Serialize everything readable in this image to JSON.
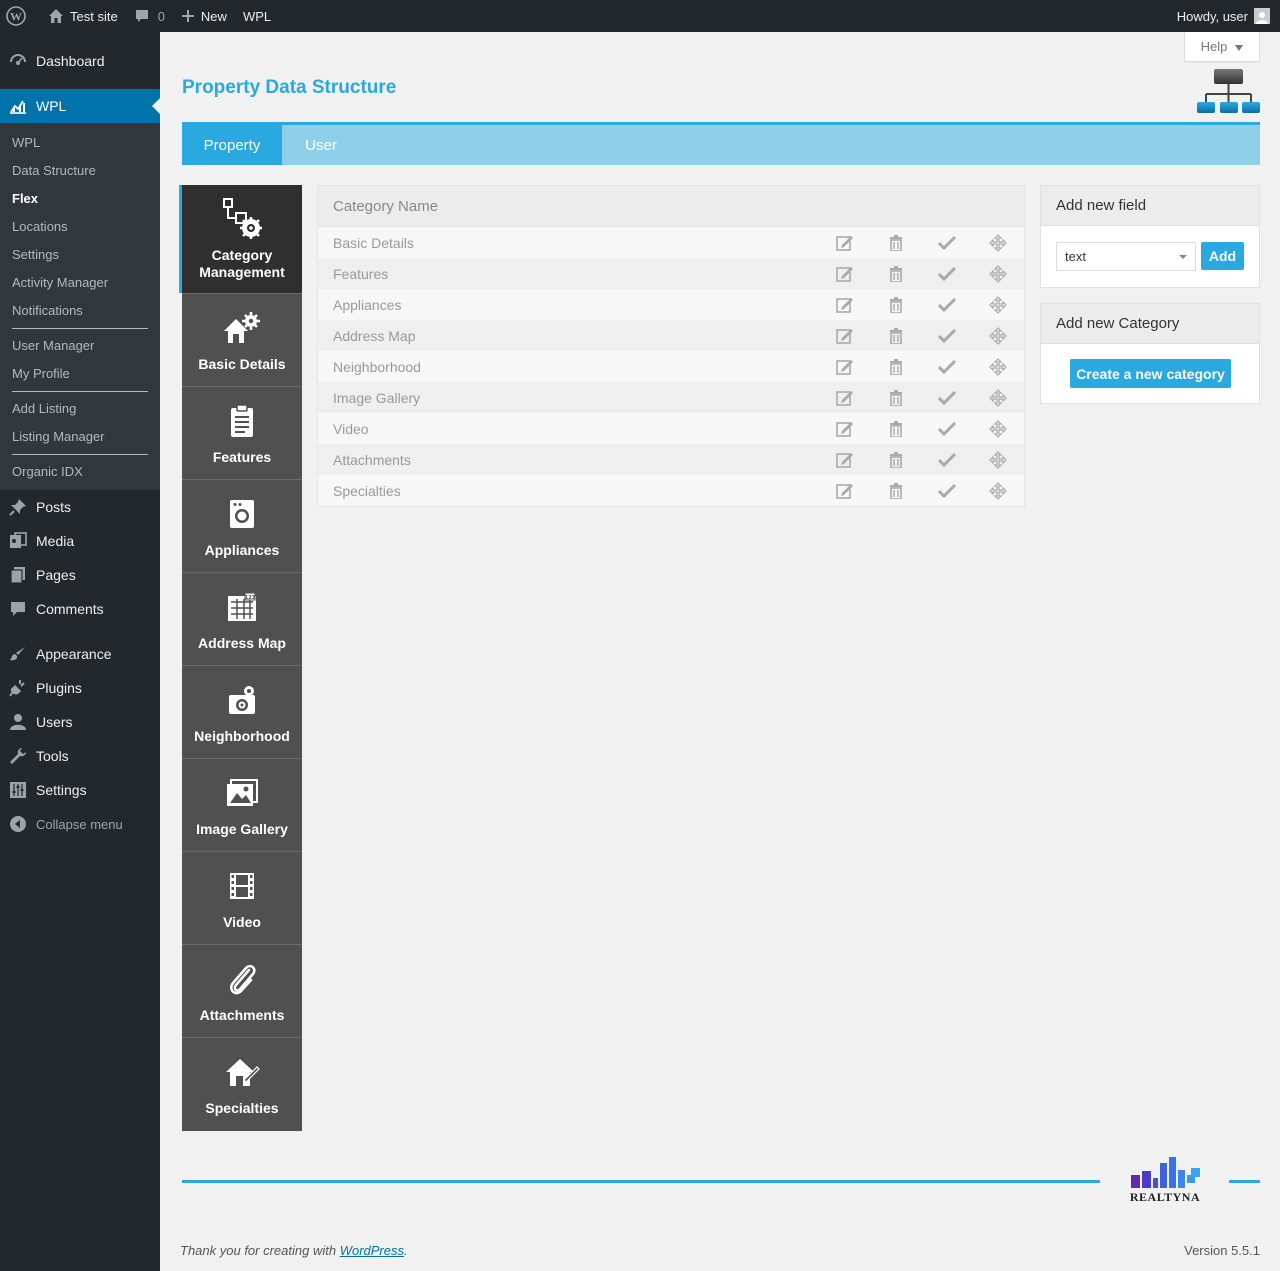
{
  "adminbar": {
    "site_name": "Test site",
    "comments_count": "0",
    "new_label": "New",
    "wpl_label": "WPL",
    "howdy": "Howdy, user"
  },
  "sidebar": {
    "dashboard": "Dashboard",
    "wpl": "WPL",
    "submenu": [
      "WPL",
      "Data Structure",
      "Flex",
      "Locations",
      "Settings",
      "Activity Manager",
      "Notifications",
      "User Manager",
      "My Profile",
      "Add Listing",
      "Listing Manager",
      "Organic IDX"
    ],
    "active_sub": "Flex",
    "posts": "Posts",
    "media": "Media",
    "pages": "Pages",
    "comments": "Comments",
    "appearance": "Appearance",
    "plugins": "Plugins",
    "users": "Users",
    "tools": "Tools",
    "settings": "Settings",
    "collapse": "Collapse menu"
  },
  "help_label": "Help",
  "page_title": "Property Data Structure",
  "tabs": [
    {
      "label": "Property",
      "active": true
    },
    {
      "label": "User",
      "active": false
    }
  ],
  "categories": [
    {
      "label": "Category Management",
      "icon": "category-management-icon"
    },
    {
      "label": "Basic Details",
      "icon": "house-gear-icon"
    },
    {
      "label": "Features",
      "icon": "clipboard-icon"
    },
    {
      "label": "Appliances",
      "icon": "washing-machine-icon"
    },
    {
      "label": "Address Map",
      "icon": "map-icon"
    },
    {
      "label": "Neighborhood",
      "icon": "neighborhood-icon"
    },
    {
      "label": "Image Gallery",
      "icon": "image-gallery-icon"
    },
    {
      "label": "Video",
      "icon": "film-icon"
    },
    {
      "label": "Attachments",
      "icon": "paperclip-icon"
    },
    {
      "label": "Specialties",
      "icon": "specialties-icon"
    }
  ],
  "table": {
    "header": "Category Name",
    "rows": [
      "Basic Details",
      "Features",
      "Appliances",
      "Address Map",
      "Neighborhood",
      "Image Gallery",
      "Video",
      "Attachments",
      "Specialties"
    ]
  },
  "add_field": {
    "title": "Add new field",
    "select_value": "text",
    "button": "Add"
  },
  "add_category": {
    "title": "Add new Category",
    "button": "Create a new category"
  },
  "footer": {
    "brand": "REALTYNA",
    "thanks_prefix": "Thank you for creating with ",
    "thanks_link": "WordPress",
    "thanks_suffix": ".",
    "version": "Version 5.5.1"
  },
  "colors": {
    "accent": "#29a9e0",
    "wp_blue": "#0073aa",
    "sidebar_bg": "#23282d"
  }
}
